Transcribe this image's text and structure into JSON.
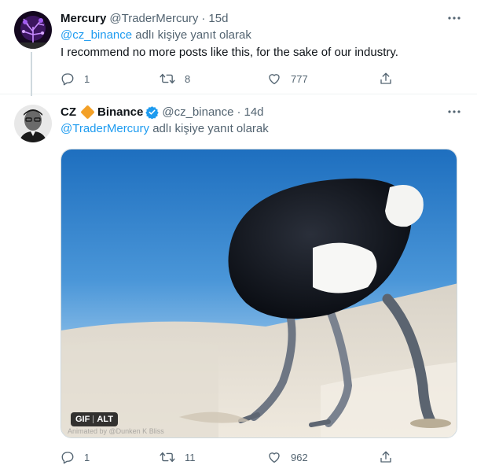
{
  "tweet1": {
    "display_name": "Mercury",
    "handle": "@TraderMercury",
    "dot": "·",
    "time": "15d",
    "reply_mention": "@cz_binance",
    "reply_suffix": "adlı kişiye yanıt olarak",
    "text": "I recommend no more posts like this, for the sake of our industry.",
    "replies": "1",
    "retweets": "8",
    "likes": "777"
  },
  "tweet2": {
    "display_name": "CZ",
    "display_name_suffix": "Binance",
    "handle": "@cz_binance",
    "dot": "·",
    "time": "14d",
    "reply_mention": "@TraderMercury",
    "reply_suffix": "adlı kişiye yanıt olarak",
    "media": {
      "badge_gif": "GIF",
      "badge_alt": "ALT",
      "watermark": "Animated by @Dunken K Bliss"
    },
    "replies": "1",
    "retweets": "11",
    "likes": "962"
  },
  "colors": {
    "accent": "#1d9bf0",
    "muted": "#536471",
    "binance": "#f3a027"
  },
  "icons": [
    "reply-icon",
    "retweet-icon",
    "like-icon",
    "share-icon",
    "more-icon",
    "verified-icon"
  ]
}
